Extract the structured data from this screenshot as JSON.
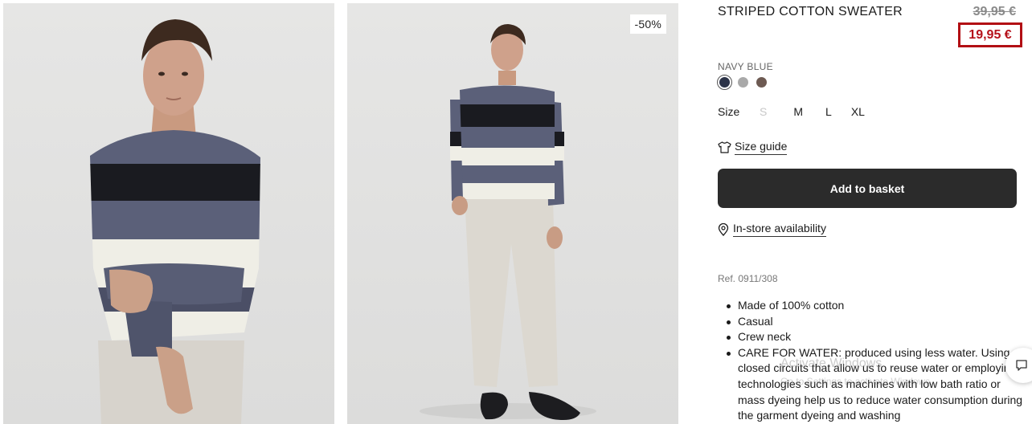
{
  "product": {
    "title": "STRIPED COTTON SWEATER",
    "old_price": "39,95 €",
    "new_price": "19,95 €",
    "discount_badge": "-50%",
    "color_name": "NAVY BLUE",
    "swatches": [
      {
        "name": "navy-blue",
        "color": "#2c3348",
        "selected": true
      },
      {
        "name": "grey",
        "color": "#a9a9a9",
        "selected": false
      },
      {
        "name": "brown",
        "color": "#6d5a52",
        "selected": false
      }
    ],
    "size_label": "Size",
    "sizes": [
      {
        "label": "S",
        "available": false
      },
      {
        "label": "M",
        "available": true
      },
      {
        "label": "L",
        "available": true
      },
      {
        "label": "XL",
        "available": true
      }
    ],
    "size_guide": "Size guide",
    "add_to_basket": "Add to basket",
    "in_store": "In-store availability",
    "ref": "Ref. 0911/308",
    "features": [
      "Made of 100% cotton",
      "Casual",
      "Crew neck",
      "CARE FOR WATER: produced using less water. Using closed circuits that allow us to reuse water or employing technologies such as machines with low bath ratio or mass dyeing help us to reduce water consumption during the garment dyeing and washing"
    ]
  },
  "overlay": {
    "watermark_title": "Activate Windows",
    "watermark_sub": "Go to Settings to activate Windows."
  },
  "colors": {
    "accent_red": "#b20f14",
    "button_dark": "#2b2b2b",
    "stripe_blue": "#5b6079",
    "stripe_black": "#1a1b20",
    "stripe_cream": "#efeee6"
  },
  "icons": [
    "tshirt-icon",
    "location-pin-icon",
    "chat-icon"
  ]
}
